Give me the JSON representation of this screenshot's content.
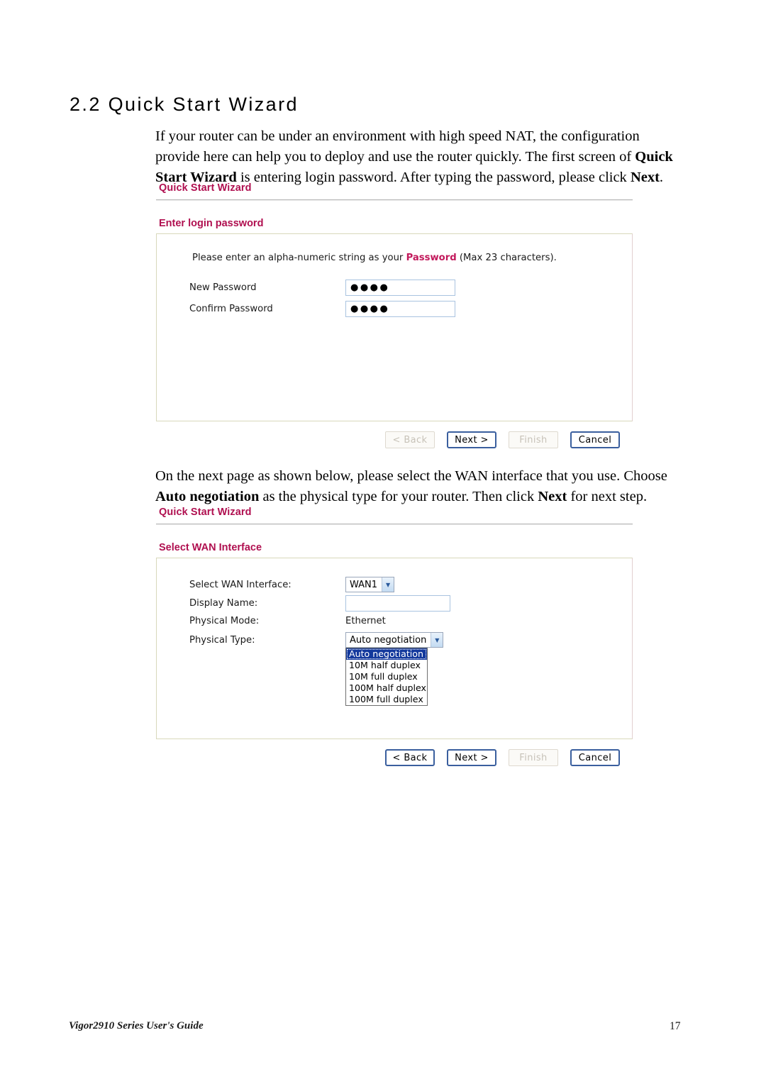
{
  "document": {
    "section_number_title": "2.2 Quick Start Wizard",
    "paragraph_1_part1": "If your router can be under an environment with high speed NAT, the configuration provide here can help you to deploy and use the router quickly. The first screen of ",
    "paragraph_1_bold1": "Quick Start Wizard",
    "paragraph_1_part2": " is entering login password. After typing the password, please click ",
    "paragraph_1_bold2": "Next",
    "paragraph_1_part3": ".",
    "paragraph_2_part1": "On the next page as shown below, please select the WAN interface that you use. Choose ",
    "paragraph_2_bold1": "Auto negotiation",
    "paragraph_2_part2": " as the physical type for your router. Then click ",
    "paragraph_2_bold2": "Next",
    "paragraph_2_part3": " for next step."
  },
  "footer": {
    "guide_name": "Vigor2910 Series User's Guide",
    "page_number": "17"
  },
  "colors": {
    "heading_red": "#b01050",
    "inline_red": "#c2185b",
    "panel_border": "#d8d8bb",
    "button_border_enabled": "#3a5f9e",
    "select_highlight": "#12389c"
  },
  "wizard_step1": {
    "title": "Quick Start Wizard",
    "subtitle": "Enter login password",
    "note_prefix": "Please enter an alpha-numeric string as your",
    "note_highlight": "Password",
    "note_suffix": "(Max 23 characters).",
    "fields": [
      {
        "label": "New Password",
        "value": "●●●●",
        "masked": true
      },
      {
        "label": "Confirm Password",
        "value": "●●●●",
        "masked": true
      }
    ],
    "buttons": [
      {
        "label": "< Back",
        "state": "disabled"
      },
      {
        "label": "Next >",
        "state": "enabled"
      },
      {
        "label": "Finish",
        "state": "disabled"
      },
      {
        "label": "Cancel",
        "state": "enabled"
      }
    ]
  },
  "wizard_step2": {
    "title": "Quick Start Wizard",
    "subtitle": "Select WAN Interface",
    "fields": {
      "wan_interface_label": "Select WAN Interface:",
      "wan_interface_value": "WAN1",
      "display_name_label": "Display Name:",
      "display_name_value": "",
      "physical_mode_label": "Physical Mode:",
      "physical_mode_value": "Ethernet",
      "physical_type_label": "Physical Type:",
      "physical_type_value": "Auto negotiation"
    },
    "physical_type_options": [
      {
        "label": "Auto negotiation",
        "selected": true
      },
      {
        "label": "10M half duplex",
        "selected": false
      },
      {
        "label": "10M full duplex",
        "selected": false
      },
      {
        "label": "100M half duplex",
        "selected": false
      },
      {
        "label": "100M full duplex",
        "selected": false
      }
    ],
    "buttons": [
      {
        "label": "< Back",
        "state": "enabled"
      },
      {
        "label": "Next >",
        "state": "enabled"
      },
      {
        "label": "Finish",
        "state": "disabled"
      },
      {
        "label": "Cancel",
        "state": "enabled"
      }
    ]
  },
  "icons": {
    "dropdown_arrow": "chevron-down-icon"
  }
}
